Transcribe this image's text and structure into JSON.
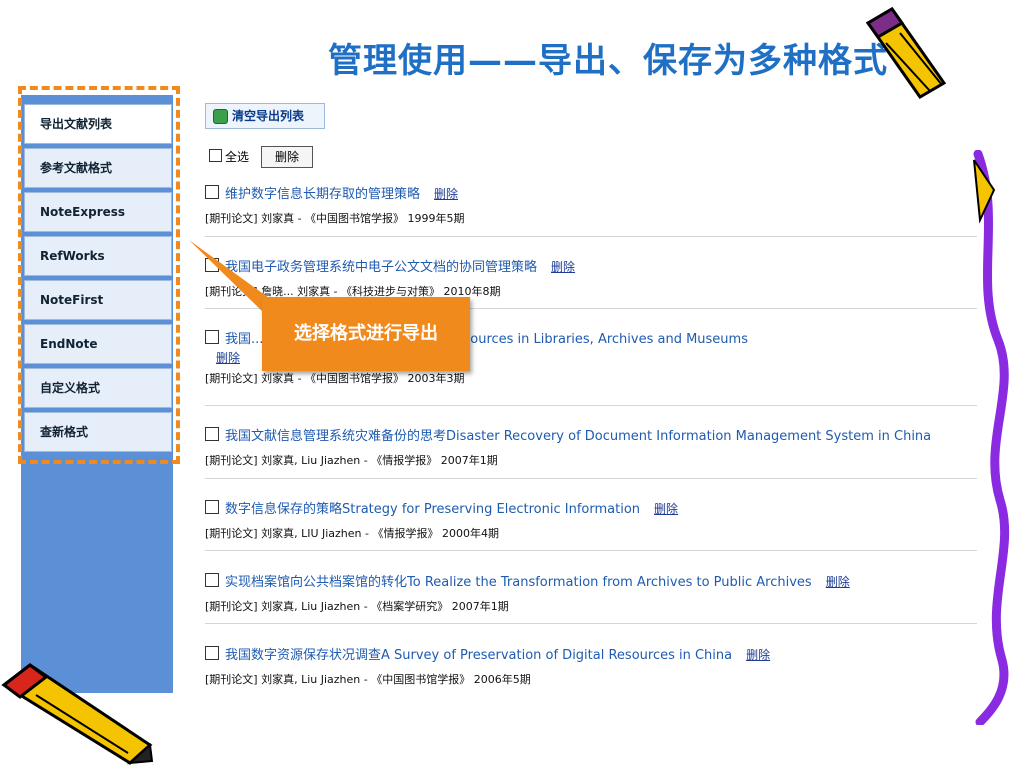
{
  "title": "管理使用——导出、保存为多种格式",
  "sidebar": {
    "items": [
      {
        "label": "导出文献列表"
      },
      {
        "label": "参考文献格式"
      },
      {
        "label": "NoteExpress"
      },
      {
        "label": "RefWorks"
      },
      {
        "label": "NoteFirst"
      },
      {
        "label": "EndNote"
      },
      {
        "label": "自定义格式"
      },
      {
        "label": "查新格式"
      }
    ]
  },
  "toolbar": {
    "clear_label": "清空导出列表"
  },
  "select": {
    "select_all_label": "全选",
    "delete_label": "删除"
  },
  "callout": {
    "text": "选择格式进行导出"
  },
  "records": [
    {
      "title": "维护数字信息长期存取的管理策略",
      "meta": "[期刊论文] 刘家真 - 《中国图书馆学报》 1999年5期",
      "delete_label": "删除"
    },
    {
      "title": "我国电子政务管理系统中电子公文文档的协同管理策略",
      "meta": "[期刊论文] 詹晓... 刘家真 - 《科技进步与对策》 2010年8期",
      "delete_label": "删除"
    },
    {
      "title": "我国... 合初探On the Integration of Resources in Libraries, Archives and Museums",
      "meta": "[期刊论文] 刘家真 - 《中国图书馆学报》 2003年3期",
      "delete_label": "删除"
    },
    {
      "title": "我国文献信息管理系统灾难备份的思考Disaster Recovery of Document Information Management System in China",
      "meta": "[期刊论文] 刘家真, Liu Jiazhen - 《情报学报》 2007年1期",
      "delete_label": ""
    },
    {
      "title": "数字信息保存的策略Strategy for Preserving Electronic Information",
      "meta": "[期刊论文] 刘家真, LIU Jiazhen - 《情报学报》 2000年4期",
      "delete_label": "删除"
    },
    {
      "title": "实现档案馆向公共档案馆的转化To Realize the Transformation from Archives to Public Archives",
      "meta": "[期刊论文] 刘家真, Liu Jiazhen - 《档案学研究》 2007年1期",
      "delete_label": "删除"
    },
    {
      "title": "我国数字资源保存状况调查A Survey of Preservation of Digital Resources in China",
      "meta": "[期刊论文] 刘家真, Liu Jiazhen - 《中国图书馆学报》 2006年5期",
      "delete_label": "删除"
    }
  ],
  "colors": {
    "accent": "#f08a1c",
    "title": "#1f6fc5",
    "sidebar": "#5b8fd6",
    "link": "#1f5bb0"
  }
}
